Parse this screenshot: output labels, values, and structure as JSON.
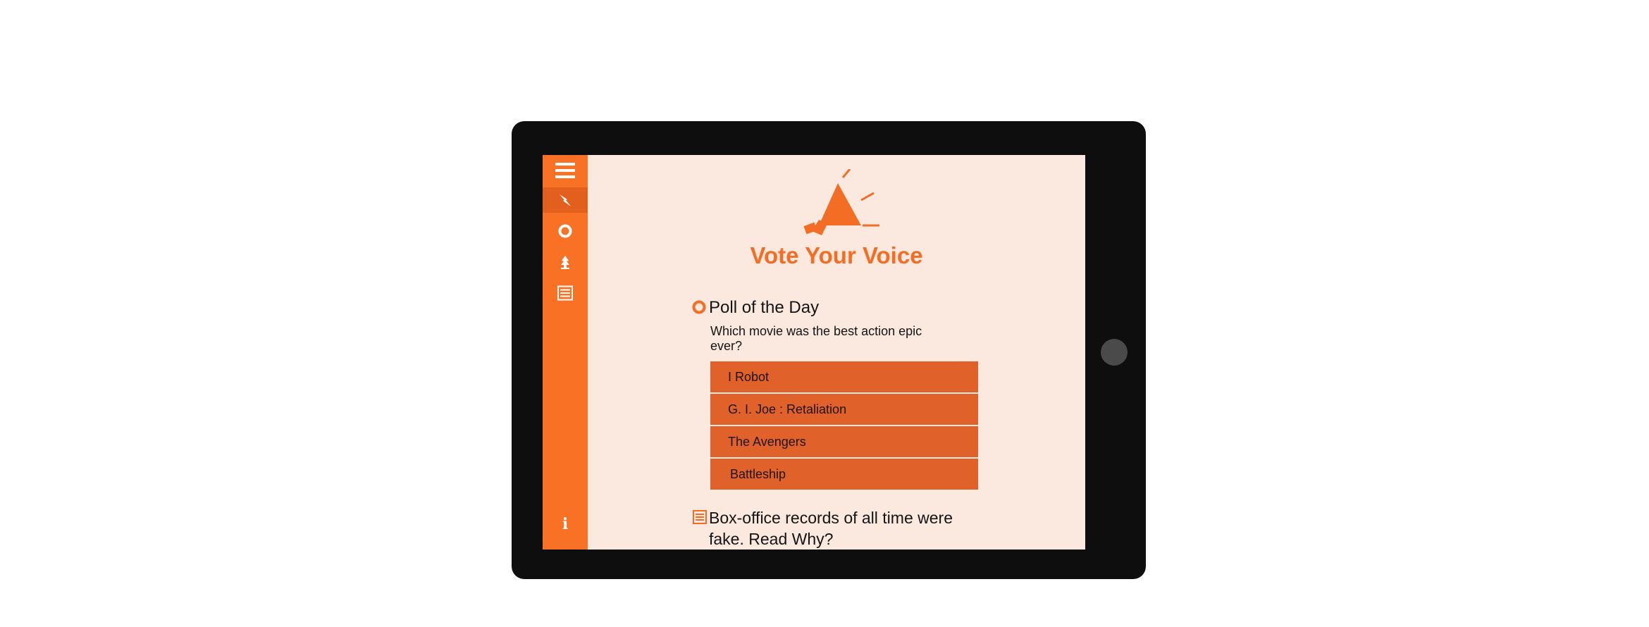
{
  "app": {
    "title": "Vote Your Voice"
  },
  "sidebar": {
    "items": [
      {
        "name": "menu",
        "icon": "hamburger-menu-icon"
      },
      {
        "name": "trending",
        "icon": "lightning-icon",
        "active": true
      },
      {
        "name": "polls",
        "icon": "ring-icon"
      },
      {
        "name": "awards",
        "icon": "trophy-icon"
      },
      {
        "name": "news",
        "icon": "list-icon"
      }
    ],
    "info_label": "i"
  },
  "poll": {
    "heading": "Poll of the Day",
    "question": "Which movie was the best action epic ever?",
    "options": [
      "I Robot",
      "G. I. Joe : Retaliation",
      "The Avengers",
      "Battleship"
    ]
  },
  "news": {
    "headline": "Box-office records of all time were fake. Read Why?"
  },
  "colors": {
    "accent": "#f97124",
    "accent_dark": "#e0622a",
    "screen_background": "#fbe8df",
    "device_frame": "#0e0e0e"
  }
}
